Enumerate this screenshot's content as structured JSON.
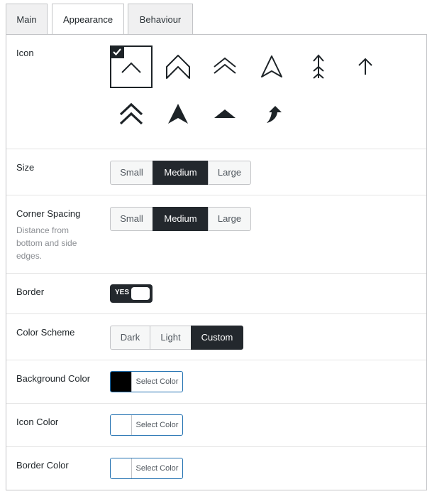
{
  "tabs": [
    {
      "label": "Main",
      "active": false
    },
    {
      "label": "Appearance",
      "active": true
    },
    {
      "label": "Behaviour",
      "active": false
    }
  ],
  "icon": {
    "label": "Icon",
    "options": [
      {
        "name": "chevron-up-icon",
        "selected": true
      },
      {
        "name": "outline-chevron-up-icon",
        "selected": false
      },
      {
        "name": "double-chevron-up-icon",
        "selected": false
      },
      {
        "name": "outline-navigation-arrow-icon",
        "selected": false
      },
      {
        "name": "feather-arrow-up-icon",
        "selected": false
      },
      {
        "name": "thin-arrow-up-icon",
        "selected": false
      },
      {
        "name": "bold-double-chevron-up-icon",
        "selected": false
      },
      {
        "name": "solid-navigation-arrow-icon",
        "selected": false
      },
      {
        "name": "solid-triangle-up-icon",
        "selected": false
      },
      {
        "name": "curved-arrow-up-icon",
        "selected": false
      }
    ]
  },
  "size": {
    "label": "Size",
    "options": [
      "Small",
      "Medium",
      "Large"
    ],
    "selected": "Medium"
  },
  "corner_spacing": {
    "label": "Corner Spacing",
    "description": "Distance from bottom and side edges.",
    "options": [
      "Small",
      "Medium",
      "Large"
    ],
    "selected": "Medium"
  },
  "border": {
    "label": "Border",
    "toggle_text": "YES",
    "on": true
  },
  "color_scheme": {
    "label": "Color Scheme",
    "options": [
      "Dark",
      "Light",
      "Custom"
    ],
    "selected": "Custom"
  },
  "background_color": {
    "label": "Background Color",
    "button_label": "Select Color",
    "value": "#000000"
  },
  "icon_color": {
    "label": "Icon Color",
    "button_label": "Select Color",
    "value": "#ffffff"
  },
  "border_color": {
    "label": "Border Color",
    "button_label": "Select Color",
    "value": "#ffffff"
  },
  "colors": {
    "accent_dark": "#23282d",
    "focus_border": "#2271b1"
  }
}
